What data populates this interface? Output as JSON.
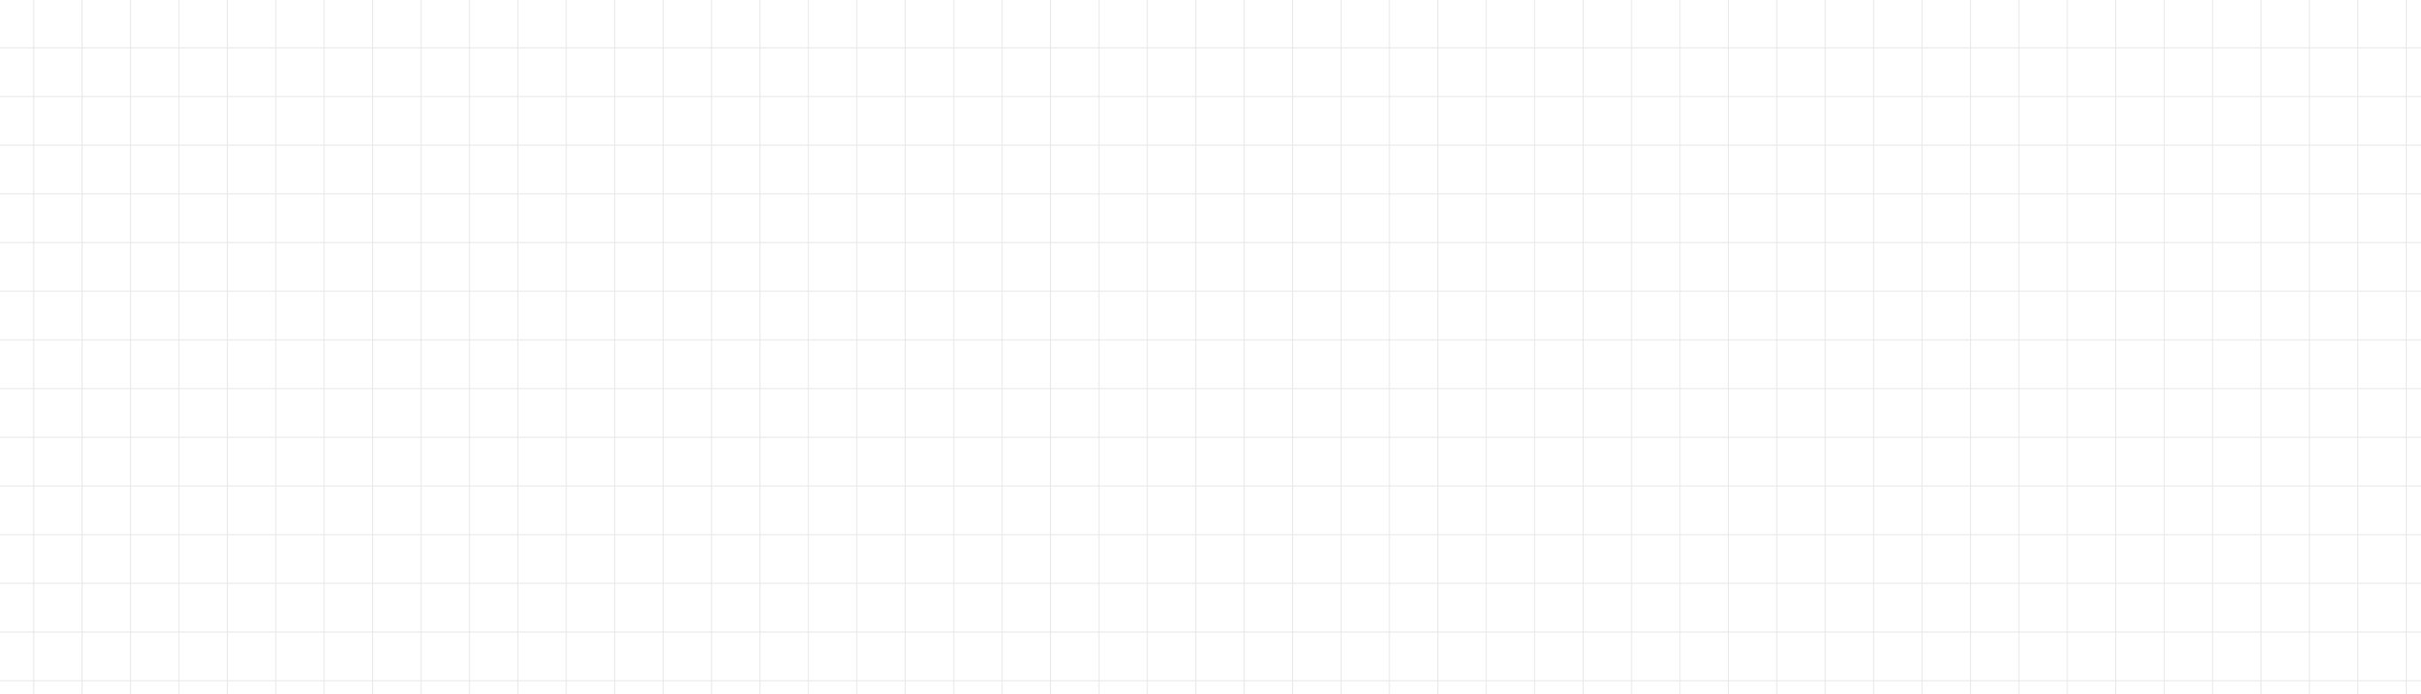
{
  "canvas": {
    "background_color": "#ffffff",
    "grid_line_color": "#e6e6e6",
    "grid_visible": true
  }
}
